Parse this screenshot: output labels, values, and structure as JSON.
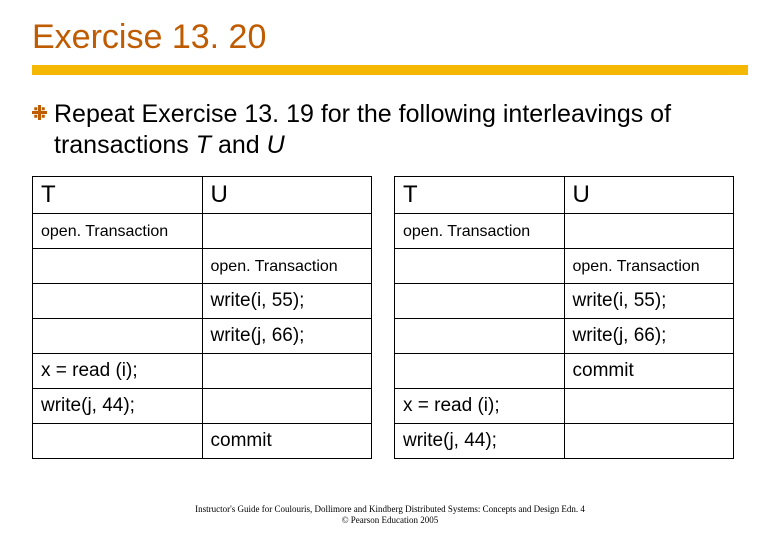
{
  "title": "Exercise 13. 20",
  "body": {
    "pre": "Repeat Exercise 13. 19 for the following interleavings of transactions ",
    "t": "T",
    "mid": " and ",
    "u": "U"
  },
  "labels": {
    "T": "T",
    "U": "U",
    "openTx": "open. Transaction",
    "write_i_55": "write(i, 55);",
    "write_j_66": "write(j, 66);",
    "x_read_i": "x = read (i);",
    "write_j_44": "write(j, 44);",
    "commit": "commit"
  },
  "footer": {
    "line1": "Instructor's Guide for Coulouris, Dollimore and Kindberg Distributed Systems: Concepts and Design Edn. 4",
    "line2": "© Pearson Education 2005"
  },
  "chart_data": [
    {
      "type": "table",
      "columns": [
        "T",
        "U"
      ],
      "rows": [
        [
          "open. Transaction",
          ""
        ],
        [
          "",
          "open. Transaction"
        ],
        [
          "",
          "write(i, 55);"
        ],
        [
          "",
          "write(j, 66);"
        ],
        [
          "x = read (i);",
          ""
        ],
        [
          "write(j, 44);",
          ""
        ],
        [
          "",
          "commit"
        ]
      ]
    },
    {
      "type": "table",
      "columns": [
        "T",
        "U"
      ],
      "rows": [
        [
          "open. Transaction",
          ""
        ],
        [
          "",
          "open. Transaction"
        ],
        [
          "",
          "write(i, 55);"
        ],
        [
          "",
          "write(j, 66);"
        ],
        [
          "",
          "commit"
        ],
        [
          "x = read (i);",
          ""
        ],
        [
          "write(j, 44);",
          ""
        ]
      ]
    }
  ]
}
